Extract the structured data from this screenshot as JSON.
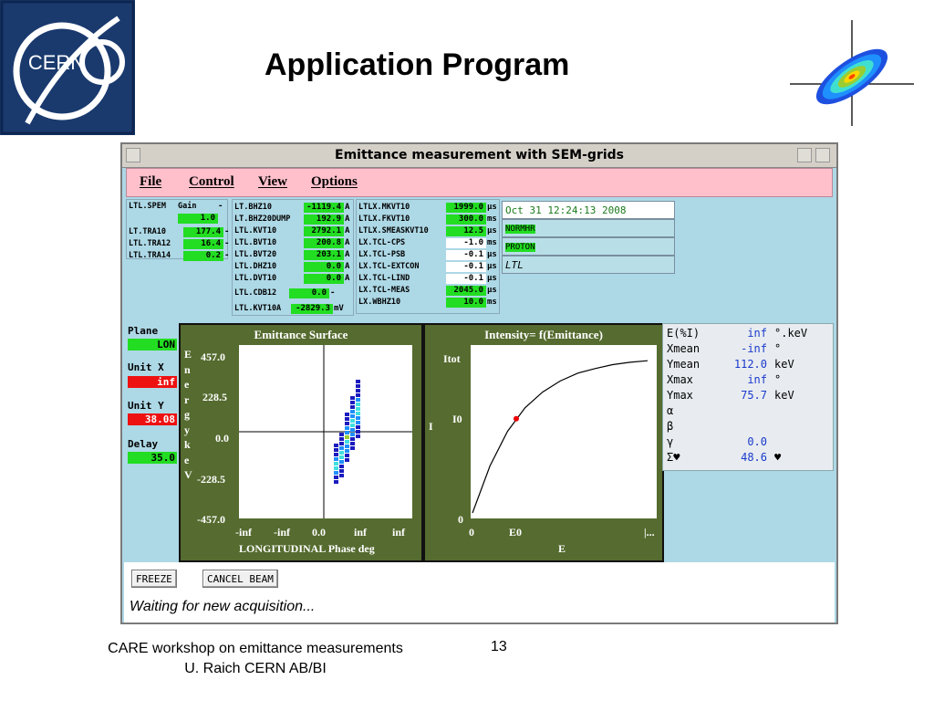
{
  "slide": {
    "title": "Application Program",
    "logo_text": "CERN",
    "footer_line1": "CARE workshop on emittance measurements",
    "footer_line2": "U. Raich CERN AB/BI",
    "page_number": "13"
  },
  "window": {
    "title": "Emittance measurement with SEM-grids"
  },
  "menu": {
    "file": "File",
    "control": "Control",
    "view": "View",
    "options": "Options"
  },
  "params_a": {
    "row1_name": "LTL.SPEM",
    "row1_label": "Gain",
    "row1_dash": "-",
    "row1_val": "1.0",
    "rows": [
      {
        "name": "LT.TRA10",
        "val": "177.4",
        "unit": "-"
      },
      {
        "name": "LTL.TRA12",
        "val": "16.4",
        "unit": "-"
      },
      {
        "name": "LTL.TRA14",
        "val": "0.2",
        "unit": "-"
      }
    ]
  },
  "params_b": {
    "rows": [
      {
        "name": "LT.BHZ10",
        "val": "-1119.4",
        "unit": "A"
      },
      {
        "name": "LT.BHZ20DUMP",
        "val": "192.9",
        "unit": "A"
      },
      {
        "name": "LTL.KVT10",
        "val": "2792.1",
        "unit": "A"
      },
      {
        "name": "LTL.BVT10",
        "val": "200.8",
        "unit": "A"
      },
      {
        "name": "LTL.BVT20",
        "val": "203.1",
        "unit": "A"
      },
      {
        "name": "LTL.DHZ10",
        "val": "0.0",
        "unit": "A"
      },
      {
        "name": "LTL.DVT10",
        "val": "0.0",
        "unit": "A"
      },
      {
        "name": "LTL.CDB12",
        "val": "0.0",
        "unit": "-"
      },
      {
        "name": "LTL.KVT10A",
        "val": "-2829.3",
        "unit": "mV"
      }
    ]
  },
  "params_c": {
    "rows": [
      {
        "name": "LTLX.MKVT10",
        "val": "1999.0",
        "unit": "µs",
        "color": "green"
      },
      {
        "name": "LTLX.FKVT10",
        "val": "300.0",
        "unit": "ms",
        "color": "green"
      },
      {
        "name": "LTLX.SMEASKVT10",
        "val": "12.5",
        "unit": "µs",
        "color": "green"
      },
      {
        "name": "LX.TCL-CPS",
        "val": "-1.0",
        "unit": "ms",
        "color": "white"
      },
      {
        "name": "LX.TCL-PSB",
        "val": "-0.1",
        "unit": "µs",
        "color": "white"
      },
      {
        "name": "LX.TCL-EXTCON",
        "val": "-0.1",
        "unit": "µs",
        "color": "white"
      },
      {
        "name": "LX.TCL-LIND",
        "val": "-0.1",
        "unit": "µs",
        "color": "white"
      },
      {
        "name": "LX.TCL-MEAS",
        "val": "2045.0",
        "unit": "µs",
        "color": "green"
      },
      {
        "name": "LX.WBHZ10",
        "val": "10.0",
        "unit": "ms",
        "color": "green"
      }
    ]
  },
  "status": {
    "datetime": "Oct 31 12:24:13 2008",
    "mode": "NORMHR",
    "particle": "PROTON",
    "line": "LTL"
  },
  "controls": {
    "plane_label": "Plane",
    "plane_value": "LON",
    "unitx_label": "Unit X",
    "unitx_value": "inf",
    "unity_label": "Unit Y",
    "unity_value": "38.08",
    "delay_label": "Delay",
    "delay_value": "35.0"
  },
  "emittance_plot": {
    "title": "Emittance Surface",
    "ylabel": "E n e r g y   k e V",
    "yticks": [
      "457.0",
      "228.5",
      "0.0",
      "-228.5",
      "-457.0"
    ],
    "xticks": [
      "-inf",
      "-inf",
      "0.0",
      "inf",
      "inf"
    ],
    "xlabel": "LONGITUDINAL Phase deg",
    "colors": {
      "dark": "#1b1bbf",
      "mid": "#1e90ff",
      "light": "#40e0e0",
      "hot": "#9acd32"
    }
  },
  "intensity_plot": {
    "title": "Intensity= f(Emittance)",
    "ylabel": "I",
    "ytick_top": "Itot",
    "ytick_mid": "I0",
    "ytick_zero": "0",
    "xtick_zero": "0",
    "xtick_e0": "E0",
    "xtick_end": "|...",
    "xlabel": "E",
    "marker_color": "#ee0000"
  },
  "chart_data": [
    {
      "type": "line",
      "title": "Intensity= f(Emittance)",
      "xlabel": "E",
      "ylabel": "I",
      "x": [
        0,
        0.1,
        0.2,
        0.3,
        0.4,
        0.5,
        0.6,
        0.7,
        0.8,
        0.9,
        1.0
      ],
      "series": [
        {
          "values": [
            0,
            0.3,
            0.52,
            0.67,
            0.77,
            0.84,
            0.89,
            0.92,
            0.945,
            0.96,
            0.97
          ]
        }
      ],
      "marker": {
        "x": 0.25,
        "y": 0.6
      }
    }
  ],
  "info": {
    "rows": [
      {
        "key": "E(%I)",
        "val": "inf",
        "unit": "°.keV"
      },
      {
        "key": "Xmean",
        "val": "-inf",
        "unit": "°"
      },
      {
        "key": "Ymean",
        "val": "112.0",
        "unit": "keV"
      },
      {
        "key": "Xmax",
        "val": "inf",
        "unit": "°"
      },
      {
        "key": "Ymax",
        "val": "75.7",
        "unit": "keV"
      },
      {
        "key": "α",
        "val": "",
        "unit": ""
      },
      {
        "key": "β",
        "val": "",
        "unit": ""
      },
      {
        "key": "γ",
        "val": "0.0",
        "unit": ""
      },
      {
        "key": "Σ♥",
        "val": "48.6",
        "unit": "♥"
      }
    ]
  },
  "bottom": {
    "freeze_label": "FREEZE",
    "cancel_label": "CANCEL BEAM",
    "message": "Waiting for new acquisition..."
  }
}
